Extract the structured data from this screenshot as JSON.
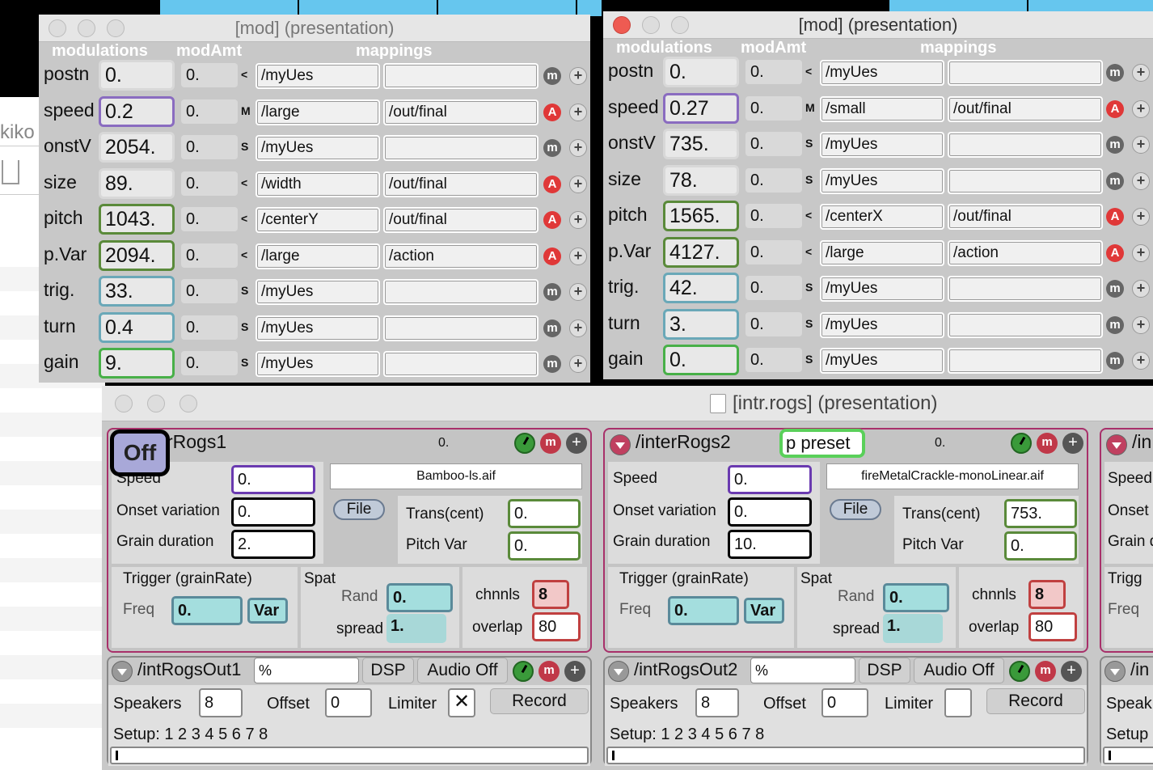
{
  "desktop": {
    "partial_text": "kiko"
  },
  "mod_windows": [
    {
      "title": "[mod] (presentation)",
      "headers": {
        "modulations": "modulations",
        "modAmt": "modAmt",
        "mappings": "mappings"
      },
      "rows": [
        {
          "label": "postn",
          "value": "0.",
          "amt": "0.",
          "mode": "<",
          "source": "/myUes",
          "target": "",
          "button": "m"
        },
        {
          "label": "speed",
          "value": "0.2",
          "amt": "0.",
          "mode": "M",
          "source": "/large",
          "target": "/out/final",
          "button": "A"
        },
        {
          "label": "onstV",
          "value": "2054.",
          "amt": "0.",
          "mode": "S",
          "source": "/myUes",
          "target": "",
          "button": "m"
        },
        {
          "label": "size",
          "value": "89.",
          "amt": "0.",
          "mode": "<",
          "source": "/width",
          "target": "/out/final",
          "button": "A"
        },
        {
          "label": "pitch",
          "value": "1043.",
          "amt": "0.",
          "mode": "<",
          "source": "/centerY",
          "target": "/out/final",
          "button": "A"
        },
        {
          "label": "p.Var",
          "value": "2094.",
          "amt": "0.",
          "mode": "<",
          "source": "/large",
          "target": "/action",
          "button": "A"
        },
        {
          "label": "trig.",
          "value": "33.",
          "amt": "0.",
          "mode": "S",
          "source": "/myUes",
          "target": "",
          "button": "m"
        },
        {
          "label": "turn",
          "value": "0.4",
          "amt": "0.",
          "mode": "S",
          "source": "/myUes",
          "target": "",
          "button": "m"
        },
        {
          "label": "gain",
          "value": "9.",
          "amt": "0.",
          "mode": "S",
          "source": "/myUes",
          "target": "",
          "button": "m"
        }
      ]
    },
    {
      "title": "[mod] (presentation)",
      "headers": {
        "modulations": "modulations",
        "modAmt": "modAmt",
        "mappings": "mappings"
      },
      "rows": [
        {
          "label": "postn",
          "value": "0.",
          "amt": "0.",
          "mode": "<",
          "source": "/myUes",
          "target": "",
          "button": "m"
        },
        {
          "label": "speed",
          "value": "0.27",
          "amt": "0.",
          "mode": "M",
          "source": "/small",
          "target": "/out/final",
          "button": "A"
        },
        {
          "label": "onstV",
          "value": "735.",
          "amt": "0.",
          "mode": "S",
          "source": "/myUes",
          "target": "",
          "button": "m"
        },
        {
          "label": "size",
          "value": "78.",
          "amt": "0.",
          "mode": "S",
          "source": "/myUes",
          "target": "",
          "button": "m"
        },
        {
          "label": "pitch",
          "value": "1565.",
          "amt": "0.",
          "mode": "<",
          "source": "/centerX",
          "target": "/out/final",
          "button": "A"
        },
        {
          "label": "p.Var",
          "value": "4127.",
          "amt": "0.",
          "mode": "<",
          "source": "/large",
          "target": "/action",
          "button": "A"
        },
        {
          "label": "trig.",
          "value": "42.",
          "amt": "0.",
          "mode": "S",
          "source": "/myUes",
          "target": "",
          "button": "m"
        },
        {
          "label": "turn",
          "value": "3.",
          "amt": "0.",
          "mode": "S",
          "source": "/myUes",
          "target": "",
          "button": "m"
        },
        {
          "label": "gain",
          "value": "0.",
          "amt": "0.",
          "mode": "S",
          "source": "/myUes",
          "target": "",
          "button": "m"
        }
      ]
    }
  ],
  "intr_window": {
    "title": "[intr.rogs] (presentation)",
    "off_label": "Off",
    "preset_label": "p preset",
    "modules": [
      {
        "name": "rRogs1",
        "value": "0.",
        "speed_label": "Speed",
        "speed": "0.",
        "onset_label": "Onset variation",
        "onset": "0.",
        "grain_label": "Grain duration",
        "grain": "2.",
        "file_name": "Bamboo-ls.aif",
        "file_btn": "File",
        "trans_label": "Trans(cent)",
        "trans": "0.",
        "pitchvar_label": "Pitch Var",
        "pitchvar": "0.",
        "trigger_label": "Trigger (grainRate)",
        "freq_label": "Freq",
        "freq": "0.",
        "var_btn": "Var",
        "spat_label": "Spat",
        "rand_label": "Rand",
        "rand": "0.",
        "spread_label": "spread",
        "spread": "1.",
        "chnnls_label": "chnnls",
        "chnnls": "8",
        "overlap_label": "overlap",
        "overlap": "80",
        "out": {
          "name": "/intRogsOut1",
          "pct": "%",
          "dsp": "DSP",
          "audio": "Audio Off",
          "speakers_label": "Speakers",
          "speakers": "8",
          "offset_label": "Offset",
          "offset": "0",
          "limiter_label": "Limiter",
          "limiter_checked": true,
          "record": "Record",
          "setup": "Setup: 1 2 3 4 5 6 7 8"
        }
      },
      {
        "name": "/interRogs2",
        "value": "0.",
        "speed_label": "Speed",
        "speed": "0.",
        "onset_label": "Onset variation",
        "onset": "0.",
        "grain_label": "Grain duration",
        "grain": "10.",
        "file_name": "fireMetalCrackle-monoLinear.aif",
        "file_btn": "File",
        "trans_label": "Trans(cent)",
        "trans": "753.",
        "pitchvar_label": "Pitch Var",
        "pitchvar": "0.",
        "trigger_label": "Trigger (grainRate)",
        "freq_label": "Freq",
        "freq": "0.",
        "var_btn": "Var",
        "spat_label": "Spat",
        "rand_label": "Rand",
        "rand": "0.",
        "spread_label": "spread",
        "spread": "1.",
        "chnnls_label": "chnnls",
        "chnnls": "8",
        "overlap_label": "overlap",
        "overlap": "80",
        "out": {
          "name": "/intRogsOut2",
          "pct": "%",
          "dsp": "DSP",
          "audio": "Audio Off",
          "speakers_label": "Speakers",
          "speakers": "8",
          "offset_label": "Offset",
          "offset": "0",
          "limiter_label": "Limiter",
          "limiter_checked": false,
          "record": "Record",
          "setup": "Setup: 1 2 3 4 5 6 7 8"
        }
      },
      {
        "name": "/in",
        "speed_label": "Speed",
        "onset_label": "Onset",
        "grain_label": "Grain d",
        "trigger_label": "Trigg",
        "freq_label": "Freq",
        "out_name": "/in",
        "speakers_label": "Speak",
        "setup_label": "Setup"
      }
    ]
  }
}
